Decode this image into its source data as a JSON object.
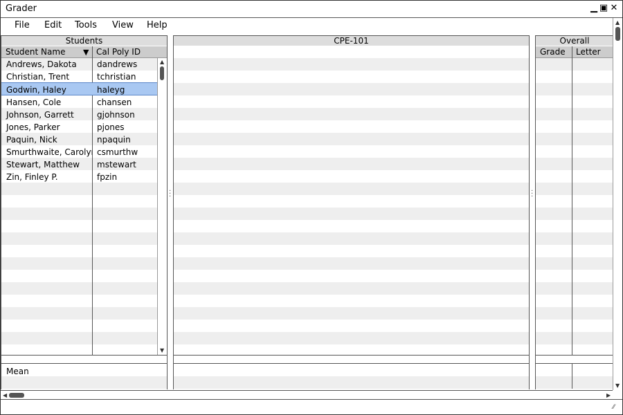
{
  "window": {
    "title": "Grader",
    "minimize_glyph": "▁",
    "maximize_glyph": "▣",
    "close_glyph": "✕"
  },
  "menu": [
    "File",
    "Edit",
    "Tools",
    "View",
    "Help"
  ],
  "students_pane": {
    "header": "Students",
    "col_name": "Student Name",
    "col_id": "Cal Poly ID",
    "sort_glyph": "▼",
    "rows": [
      {
        "name": "Andrews, Dakota",
        "id": "dandrews"
      },
      {
        "name": "Christian, Trent",
        "id": "tchristian"
      },
      {
        "name": "Godwin, Haley",
        "id": "haleyg"
      },
      {
        "name": "Hansen, Cole",
        "id": "chansen"
      },
      {
        "name": "Johnson, Garrett",
        "id": "gjohnson"
      },
      {
        "name": "Jones, Parker",
        "id": "pjones"
      },
      {
        "name": "Paquin, Nick",
        "id": "npaquin"
      },
      {
        "name": "Smurthwaite, Carolyn",
        "id": "csmurthw"
      },
      {
        "name": "Stewart, Matthew",
        "id": "mstewart"
      },
      {
        "name": "Zin, Finley P.",
        "id": "fpzin"
      }
    ],
    "selected_index": 2,
    "footer_label": "Mean"
  },
  "course_pane": {
    "header": "CPE-101"
  },
  "overall_pane": {
    "header": "Overall",
    "col_grade": "Grade",
    "col_letter": "Letter"
  },
  "scroll": {
    "up_glyph": "▲",
    "down_glyph": "▼",
    "left_glyph": "◀",
    "right_glyph": "▶",
    "resize_glyph": "⁄⁄"
  }
}
